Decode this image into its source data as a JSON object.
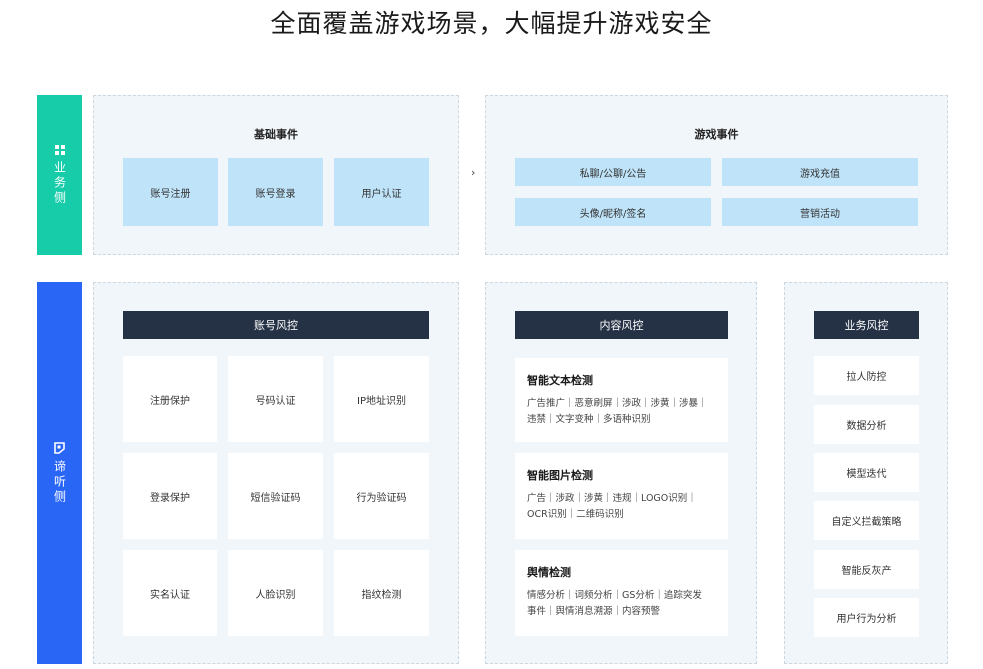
{
  "title": "全面覆盖游戏场景，大幅提升游戏安全",
  "colors": {
    "teal": "#17cca9",
    "blue": "#2a66f6",
    "dark_bar": "#253246",
    "light_box": "#bfe3f8",
    "panel_bg": "#f1f6fa"
  },
  "business_side": {
    "icon": "grid-icon",
    "label": "业务侧"
  },
  "listen_side": {
    "icon": "listen-icon",
    "label": "谛听侧"
  },
  "basic_events": {
    "title": "基础事件",
    "items": [
      "账号注册",
      "账号登录",
      "用户认证"
    ]
  },
  "arrow": "›",
  "game_events": {
    "title": "游戏事件",
    "items": [
      "私聊/公聊/公告",
      "游戏充值",
      "头像/昵称/签名",
      "营销活动"
    ]
  },
  "account_risk": {
    "title": "账号风控",
    "items": [
      "注册保护",
      "号码认证",
      "IP地址识别",
      "登录保护",
      "短信验证码",
      "行为验证码",
      "实名认证",
      "人脸识别",
      "指纹检测"
    ]
  },
  "content_risk": {
    "title": "内容风控",
    "items": [
      {
        "title": "智能文本检测",
        "desc1": "广告推广｜恶意刷屏｜涉政｜涉黄｜涉暴｜",
        "desc2": "违禁｜文字变种｜多语种识别"
      },
      {
        "title": "智能图片检测",
        "desc1": "广告｜涉政｜涉黄｜违规｜LOGO识别｜",
        "desc2": "OCR识别｜二维码识别"
      },
      {
        "title": "舆情检测",
        "desc1": "情感分析｜词频分析｜GS分析｜追踪突发",
        "desc2": "事件｜舆情消息溯源｜内容预警"
      }
    ]
  },
  "business_risk": {
    "title": "业务风控",
    "items": [
      "拉人防控",
      "数据分析",
      "模型迭代",
      "自定义拦截策略",
      "智能反灰产",
      "用户行为分析"
    ]
  }
}
